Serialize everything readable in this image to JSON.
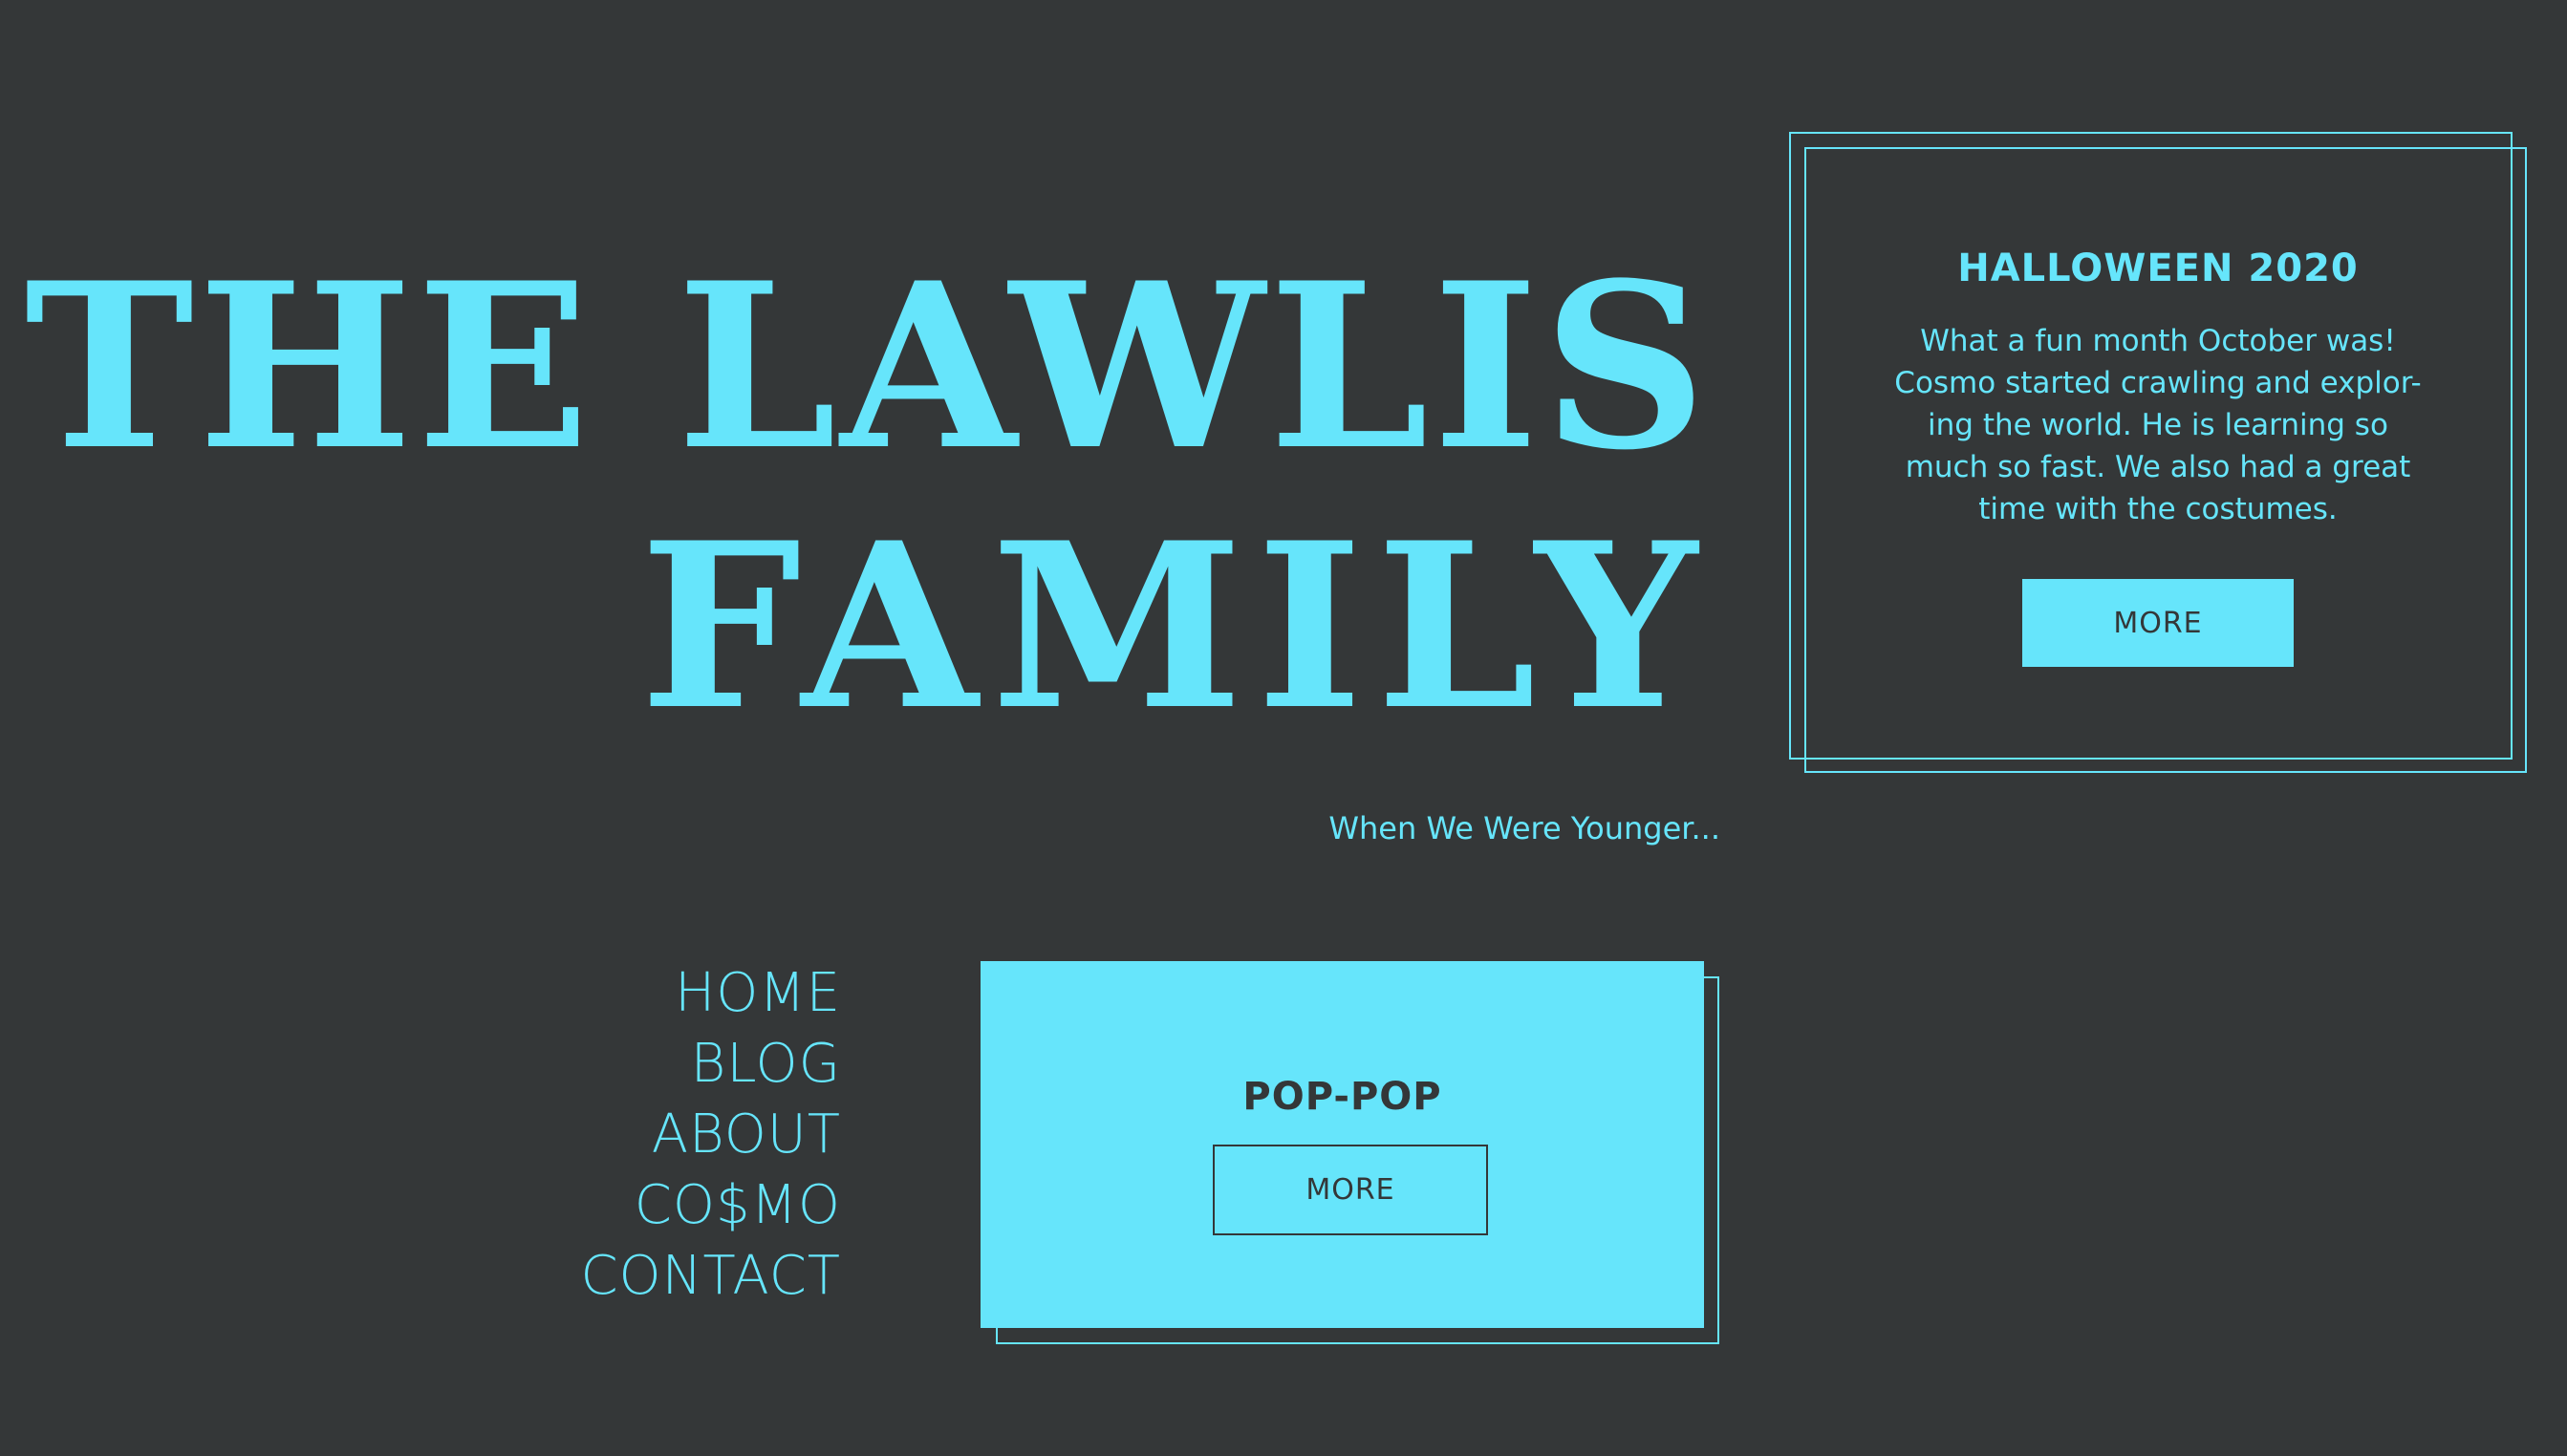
{
  "header": {
    "title_line_1": "THE LAWLIS",
    "title_line_2": "FAMILY",
    "tagline": "When We Were Younger..."
  },
  "featured_post": {
    "title": "HALLOWEEN 2020",
    "body": "What a fun month October was! Cosmo started crawling and explor-ing the world. He is learning so much so fast. We also had a great time with the costumes.",
    "button_label": "MORE"
  },
  "nav": {
    "items": [
      {
        "label": "HOME"
      },
      {
        "label": "BLOG"
      },
      {
        "label": "ABOUT"
      },
      {
        "label": "CO$MO"
      },
      {
        "label": "CONTACT"
      }
    ]
  },
  "secondary_post": {
    "title": "POP-POP",
    "button_label": "MORE"
  },
  "colors": {
    "background": "#343738",
    "accent": "#66e5fb"
  }
}
